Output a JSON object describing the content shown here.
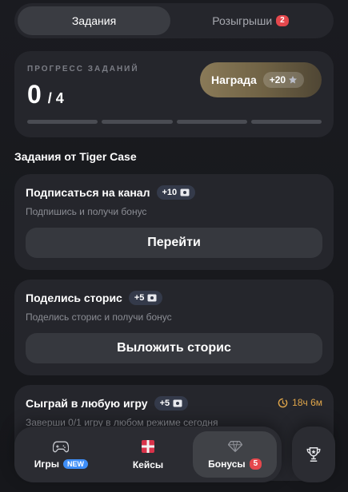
{
  "tabs": {
    "tasks_label": "Задания",
    "raffles_label": "Розыгрыши",
    "raffles_badge": "2"
  },
  "progress": {
    "label": "ПРОГРЕСС ЗАДАНИЙ",
    "completed": "0",
    "total": "/ 4",
    "reward_label": "Награда",
    "reward_value": "+20",
    "segments_filled": 0,
    "segments_total": 4
  },
  "section_title": "Задания от Tiger Case",
  "tasks": [
    {
      "title": "Подписаться на канал",
      "xp": "+10",
      "desc": "Подпишись и получи бонус",
      "button": "Перейти"
    },
    {
      "title": "Поделись сторис",
      "xp": "+5",
      "desc": "Поделись сторис и получи бонус",
      "button": "Выложить сторис"
    },
    {
      "title": "Сыграй в любую игру",
      "xp": "+5",
      "desc": "Заверши 0/1 игру в любом режиме сегодня",
      "timer": "18ч 6м"
    }
  ],
  "nav": {
    "games_label": "Игры",
    "games_badge": "NEW",
    "cases_label": "Кейсы",
    "bonuses_label": "Бонусы",
    "bonuses_badge": "5"
  },
  "colors": {
    "accent_gold": "#8a7a58",
    "badge_red": "#e5484d",
    "badge_blue": "#3e8ef7",
    "timer_orange": "#e0a64a"
  }
}
